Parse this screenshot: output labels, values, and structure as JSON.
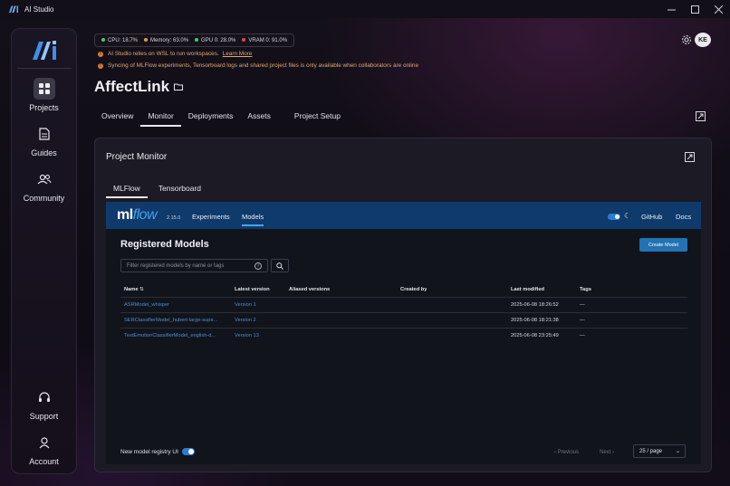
{
  "window": {
    "title": "AI Studio"
  },
  "sidebar": {
    "items": [
      {
        "label": "Projects",
        "icon": "grid-icon",
        "active": true
      },
      {
        "label": "Guides",
        "icon": "document-icon",
        "active": false
      },
      {
        "label": "Community",
        "icon": "people-icon",
        "active": false
      },
      {
        "label": "Support",
        "icon": "headset-icon",
        "active": false
      },
      {
        "label": "Account",
        "icon": "user-icon",
        "active": false
      }
    ]
  },
  "status": {
    "cpu": "CPU: 18.7%",
    "memory": "Memory: 63.0%",
    "gpu": "GPU 0: 28.0%",
    "vram": "VRAM 0: 91.0%",
    "colors": {
      "cpu": "#3ecf6a",
      "memory": "#e0a040",
      "gpu": "#3ecf6a",
      "vram": "#e04848"
    }
  },
  "notices": [
    {
      "text": "AI Studio relies on WSL to run workspaces.",
      "link": "Learn More"
    },
    {
      "text": "Syncing of MLFlow experiments, Tensorboard logs and shared project files is only available when collaborators are online",
      "link": ""
    }
  ],
  "user": {
    "initials": "KE"
  },
  "project": {
    "title": "AffectLink",
    "tabs": [
      "Overview",
      "Monitor",
      "Deployments",
      "Assets",
      "Project Setup"
    ],
    "active_tab": "Monitor"
  },
  "monitor": {
    "title": "Project Monitor",
    "subtabs": [
      "MLFlow",
      "Tensorboard"
    ],
    "active_subtab": "MLFlow"
  },
  "mlflow": {
    "logo_ml": "ml",
    "logo_flow": "flow",
    "version": "2.15.0",
    "nav": [
      "Experiments",
      "Models"
    ],
    "active_nav": "Models",
    "links": [
      "GitHub",
      "Docs"
    ],
    "page_title": "Registered Models",
    "create_button": "Create Model",
    "search_placeholder": "Filter registered models by name or tags",
    "columns": [
      "Name",
      "Latest version",
      "Aliased versions",
      "Created by",
      "Last modified",
      "Tags"
    ],
    "rows": [
      {
        "name": "ASRModel_whisper",
        "version": "Version 1",
        "aliased": "",
        "created_by": "",
        "modified": "2025-06-08 18:26:52",
        "tags": "—"
      },
      {
        "name": "SERClassifierModel_hubert-large-supe...",
        "version": "Version 2",
        "aliased": "",
        "created_by": "",
        "modified": "2025-06-08 18:21:38",
        "tags": "—"
      },
      {
        "name": "TextEmotionClassifierModel_english-d...",
        "version": "Version 13",
        "aliased": "",
        "created_by": "",
        "modified": "2025-06-08 23:25:49",
        "tags": "—"
      }
    ],
    "footer": {
      "new_ui_label": "New model registry UI",
      "previous": "Previous",
      "next": "Next",
      "page_size": "25 / page"
    }
  }
}
